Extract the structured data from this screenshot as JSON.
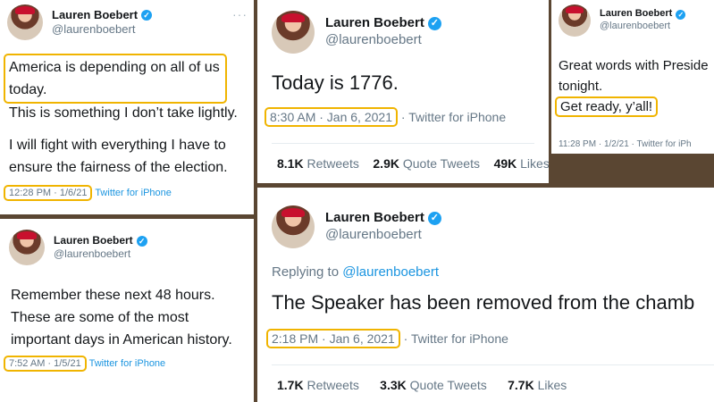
{
  "author": {
    "name": "Lauren Boebert",
    "handle": "@laurenboebert",
    "verified_icon": "check-icon"
  },
  "tweets": {
    "t1": {
      "highlight_text": "America is depending on all of us today.",
      "line2": "This is something I don’t take lightly.",
      "line3": "I will fight with everything I have to ensure the fairness of the election.",
      "time": "12:28 PM · 1/6/21",
      "source": "Twitter for iPhone"
    },
    "t2": {
      "text": "Today is 1776.",
      "time": "8:30 AM · Jan 6, 2021",
      "separator": "·",
      "source": "Twitter for iPhone",
      "stats": [
        {
          "count": "8.1K",
          "label": "Retweets"
        },
        {
          "count": "2.9K",
          "label": "Quote Tweets"
        },
        {
          "count": "49K",
          "label": "Likes"
        }
      ]
    },
    "t3": {
      "text": "Great words with Preside tonight.",
      "highlight_text": "Get ready, y’all!",
      "time": "11:28 PM · 1/2/21 · Twitter for iPh"
    },
    "t4": {
      "text": "Remember these next 48 hours. These are some of the most important days in American history.",
      "time": "7:52 AM · 1/5/21",
      "source": "Twitter for iPhone"
    },
    "t5": {
      "replying_prefix": "Replying to ",
      "replying_handle": "@laurenboebert",
      "text": "The Speaker has been removed from the chamb",
      "time": "2:18 PM · Jan 6, 2021",
      "separator": "·",
      "source": "Twitter for iPhone",
      "stats": [
        {
          "count": "1.7K",
          "label": "Retweets"
        },
        {
          "count": "3.3K",
          "label": "Quote Tweets"
        },
        {
          "count": "7.7K",
          "label": "Likes"
        }
      ]
    }
  },
  "more_icon": "···",
  "colors": {
    "highlight": "#f0b400",
    "link": "#1b95e0",
    "muted": "#657786",
    "verified": "#1da1f2"
  }
}
